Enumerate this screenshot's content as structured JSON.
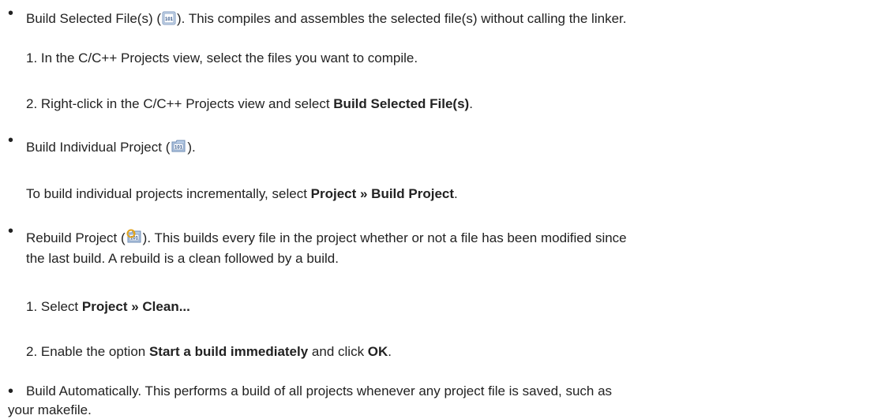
{
  "items": [
    {
      "lead": "Build Selected File(s) (",
      "icon": "build-file-icon",
      "rest": "). This compiles and assembles the selected file(s) without calling the linker.",
      "steps": [
        {
          "pre": "1. In the C/C++ Projects view, select the files you want to compile.",
          "bold": "",
          "post": ""
        },
        {
          "pre": "2. Right-click in the C/C++ Projects view and select ",
          "bold": "Build Selected File(s)",
          "post": "."
        }
      ]
    },
    {
      "lead": "Build Individual Project (",
      "icon": "build-project-icon",
      "rest": ").",
      "para": {
        "pre": "To build individual projects incrementally, select ",
        "bold": "Project » Build Project",
        "post": "."
      }
    },
    {
      "lead": "Rebuild Project (",
      "icon": "rebuild-project-icon",
      "rest": "). This builds every file in the project whether or not a file has been modified since",
      "rest2": "the last build. A rebuild is a clean followed by a build.",
      "steps": [
        {
          "pre": "1. Select ",
          "bold": "Project » Clean...",
          "post": ""
        },
        {
          "pre": "2. Enable the option ",
          "bold": "Start a build immediately",
          "post": " and click ",
          "bold2": "OK",
          "post2": "."
        }
      ]
    },
    {
      "text1": "Build Automatically. This performs a build of all projects whenever any project file is saved, such as",
      "text2": "your makefile."
    }
  ]
}
